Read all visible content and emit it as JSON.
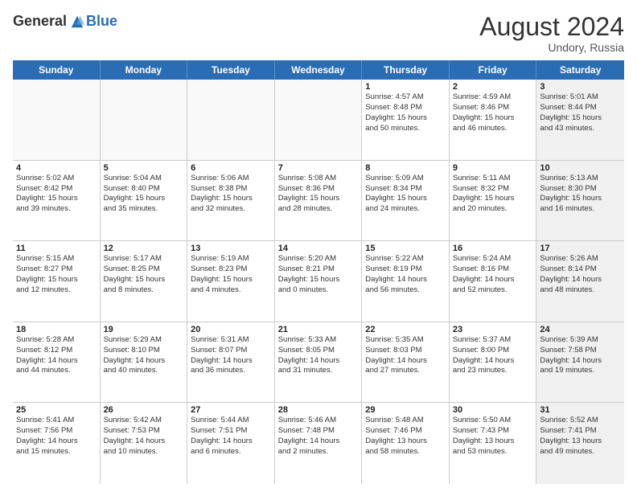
{
  "header": {
    "logo_general": "General",
    "logo_blue": "Blue",
    "month_year": "August 2024",
    "location": "Undory, Russia"
  },
  "weekdays": [
    "Sunday",
    "Monday",
    "Tuesday",
    "Wednesday",
    "Thursday",
    "Friday",
    "Saturday"
  ],
  "rows": [
    [
      {
        "day": "",
        "lines": [],
        "empty": true
      },
      {
        "day": "",
        "lines": [],
        "empty": true
      },
      {
        "day": "",
        "lines": [],
        "empty": true
      },
      {
        "day": "",
        "lines": [],
        "empty": true
      },
      {
        "day": "1",
        "lines": [
          "Sunrise: 4:57 AM",
          "Sunset: 8:48 PM",
          "Daylight: 15 hours",
          "and 50 minutes."
        ]
      },
      {
        "day": "2",
        "lines": [
          "Sunrise: 4:59 AM",
          "Sunset: 8:46 PM",
          "Daylight: 15 hours",
          "and 46 minutes."
        ]
      },
      {
        "day": "3",
        "lines": [
          "Sunrise: 5:01 AM",
          "Sunset: 8:44 PM",
          "Daylight: 15 hours",
          "and 43 minutes."
        ],
        "shaded": true
      }
    ],
    [
      {
        "day": "4",
        "lines": [
          "Sunrise: 5:02 AM",
          "Sunset: 8:42 PM",
          "Daylight: 15 hours",
          "and 39 minutes."
        ]
      },
      {
        "day": "5",
        "lines": [
          "Sunrise: 5:04 AM",
          "Sunset: 8:40 PM",
          "Daylight: 15 hours",
          "and 35 minutes."
        ]
      },
      {
        "day": "6",
        "lines": [
          "Sunrise: 5:06 AM",
          "Sunset: 8:38 PM",
          "Daylight: 15 hours",
          "and 32 minutes."
        ]
      },
      {
        "day": "7",
        "lines": [
          "Sunrise: 5:08 AM",
          "Sunset: 8:36 PM",
          "Daylight: 15 hours",
          "and 28 minutes."
        ]
      },
      {
        "day": "8",
        "lines": [
          "Sunrise: 5:09 AM",
          "Sunset: 8:34 PM",
          "Daylight: 15 hours",
          "and 24 minutes."
        ]
      },
      {
        "day": "9",
        "lines": [
          "Sunrise: 5:11 AM",
          "Sunset: 8:32 PM",
          "Daylight: 15 hours",
          "and 20 minutes."
        ]
      },
      {
        "day": "10",
        "lines": [
          "Sunrise: 5:13 AM",
          "Sunset: 8:30 PM",
          "Daylight: 15 hours",
          "and 16 minutes."
        ],
        "shaded": true
      }
    ],
    [
      {
        "day": "11",
        "lines": [
          "Sunrise: 5:15 AM",
          "Sunset: 8:27 PM",
          "Daylight: 15 hours",
          "and 12 minutes."
        ]
      },
      {
        "day": "12",
        "lines": [
          "Sunrise: 5:17 AM",
          "Sunset: 8:25 PM",
          "Daylight: 15 hours",
          "and 8 minutes."
        ]
      },
      {
        "day": "13",
        "lines": [
          "Sunrise: 5:19 AM",
          "Sunset: 8:23 PM",
          "Daylight: 15 hours",
          "and 4 minutes."
        ]
      },
      {
        "day": "14",
        "lines": [
          "Sunrise: 5:20 AM",
          "Sunset: 8:21 PM",
          "Daylight: 15 hours",
          "and 0 minutes."
        ]
      },
      {
        "day": "15",
        "lines": [
          "Sunrise: 5:22 AM",
          "Sunset: 8:19 PM",
          "Daylight: 14 hours",
          "and 56 minutes."
        ]
      },
      {
        "day": "16",
        "lines": [
          "Sunrise: 5:24 AM",
          "Sunset: 8:16 PM",
          "Daylight: 14 hours",
          "and 52 minutes."
        ]
      },
      {
        "day": "17",
        "lines": [
          "Sunrise: 5:26 AM",
          "Sunset: 8:14 PM",
          "Daylight: 14 hours",
          "and 48 minutes."
        ],
        "shaded": true
      }
    ],
    [
      {
        "day": "18",
        "lines": [
          "Sunrise: 5:28 AM",
          "Sunset: 8:12 PM",
          "Daylight: 14 hours",
          "and 44 minutes."
        ]
      },
      {
        "day": "19",
        "lines": [
          "Sunrise: 5:29 AM",
          "Sunset: 8:10 PM",
          "Daylight: 14 hours",
          "and 40 minutes."
        ]
      },
      {
        "day": "20",
        "lines": [
          "Sunrise: 5:31 AM",
          "Sunset: 8:07 PM",
          "Daylight: 14 hours",
          "and 36 minutes."
        ]
      },
      {
        "day": "21",
        "lines": [
          "Sunrise: 5:33 AM",
          "Sunset: 8:05 PM",
          "Daylight: 14 hours",
          "and 31 minutes."
        ]
      },
      {
        "day": "22",
        "lines": [
          "Sunrise: 5:35 AM",
          "Sunset: 8:03 PM",
          "Daylight: 14 hours",
          "and 27 minutes."
        ]
      },
      {
        "day": "23",
        "lines": [
          "Sunrise: 5:37 AM",
          "Sunset: 8:00 PM",
          "Daylight: 14 hours",
          "and 23 minutes."
        ]
      },
      {
        "day": "24",
        "lines": [
          "Sunrise: 5:39 AM",
          "Sunset: 7:58 PM",
          "Daylight: 14 hours",
          "and 19 minutes."
        ],
        "shaded": true
      }
    ],
    [
      {
        "day": "25",
        "lines": [
          "Sunrise: 5:41 AM",
          "Sunset: 7:56 PM",
          "Daylight: 14 hours",
          "and 15 minutes."
        ]
      },
      {
        "day": "26",
        "lines": [
          "Sunrise: 5:42 AM",
          "Sunset: 7:53 PM",
          "Daylight: 14 hours",
          "and 10 minutes."
        ]
      },
      {
        "day": "27",
        "lines": [
          "Sunrise: 5:44 AM",
          "Sunset: 7:51 PM",
          "Daylight: 14 hours",
          "and 6 minutes."
        ]
      },
      {
        "day": "28",
        "lines": [
          "Sunrise: 5:46 AM",
          "Sunset: 7:48 PM",
          "Daylight: 14 hours",
          "and 2 minutes."
        ]
      },
      {
        "day": "29",
        "lines": [
          "Sunrise: 5:48 AM",
          "Sunset: 7:46 PM",
          "Daylight: 13 hours",
          "and 58 minutes."
        ]
      },
      {
        "day": "30",
        "lines": [
          "Sunrise: 5:50 AM",
          "Sunset: 7:43 PM",
          "Daylight: 13 hours",
          "and 53 minutes."
        ]
      },
      {
        "day": "31",
        "lines": [
          "Sunrise: 5:52 AM",
          "Sunset: 7:41 PM",
          "Daylight: 13 hours",
          "and 49 minutes."
        ],
        "shaded": true
      }
    ]
  ]
}
